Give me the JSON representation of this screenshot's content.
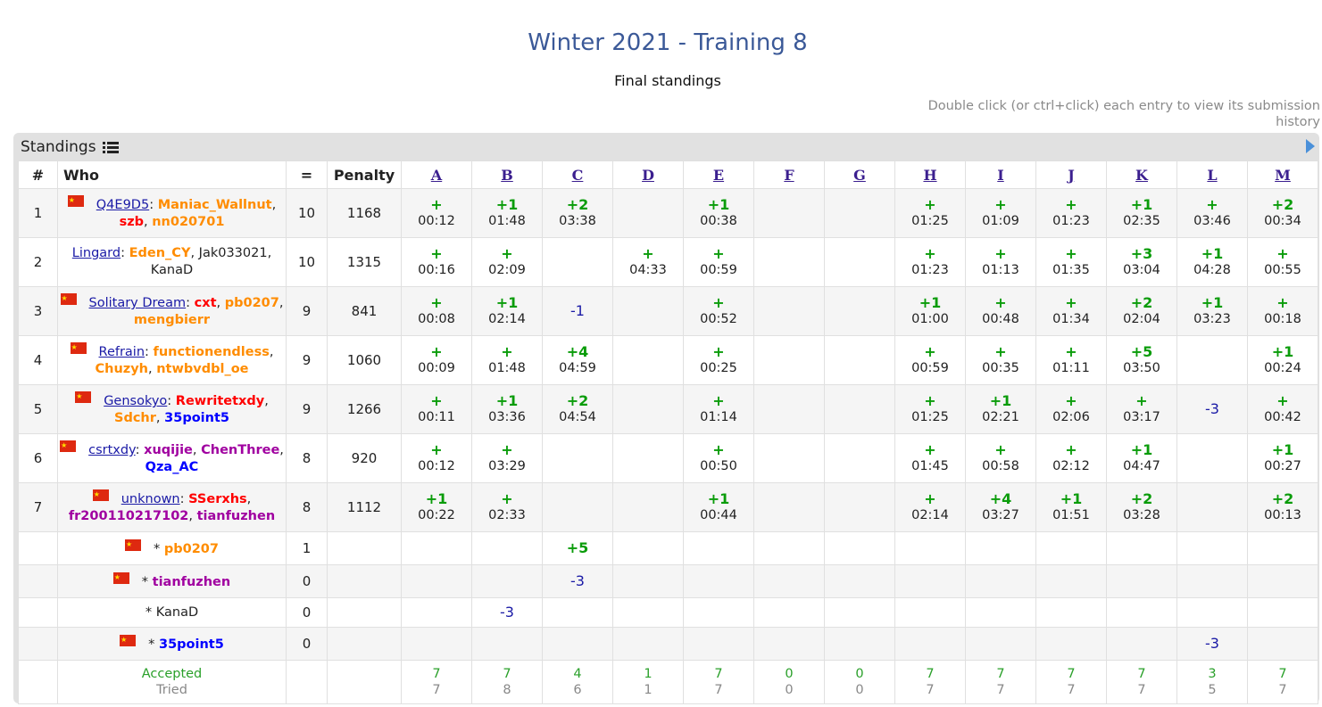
{
  "header": {
    "title": "Winter 2021 - Training 8",
    "subtitle": "Final standings",
    "hint": "Double click (or ctrl+click) each entry to view its submission history"
  },
  "panel": {
    "title": "Standings"
  },
  "columns": {
    "rank": "#",
    "who": "Who",
    "solved": "=",
    "penalty": "Penalty",
    "problems": [
      "A",
      "B",
      "C",
      "D",
      "E",
      "F",
      "G",
      "H",
      "I",
      "J",
      "K",
      "L",
      "M"
    ]
  },
  "rows": [
    {
      "rank": "1",
      "flag": true,
      "team": "Q4E9D5",
      "members": [
        {
          "name": "Maniac_Wallnut",
          "color": "orange"
        },
        {
          "name": "szb",
          "color": "red"
        },
        {
          "name": "nn020701",
          "color": "orange"
        }
      ],
      "solved": "10",
      "penalty": "1168",
      "cells": [
        [
          "+",
          "00:12"
        ],
        [
          "+1",
          "01:48"
        ],
        [
          "+2",
          "03:38"
        ],
        null,
        [
          "+1",
          "00:38"
        ],
        null,
        null,
        [
          "+",
          "01:25"
        ],
        [
          "+",
          "01:09"
        ],
        [
          "+",
          "01:23"
        ],
        [
          "+1",
          "02:35"
        ],
        [
          "+",
          "03:46"
        ],
        [
          "+2",
          "00:34"
        ]
      ]
    },
    {
      "rank": "2",
      "flag": false,
      "team": "Lingard",
      "members": [
        {
          "name": "Eden_CY",
          "color": "orange"
        },
        {
          "name": "Jak033021",
          "color": "gray"
        },
        {
          "name": "KanaD",
          "color": "gray"
        }
      ],
      "solved": "10",
      "penalty": "1315",
      "cells": [
        [
          "+",
          "00:16"
        ],
        [
          "+",
          "02:09"
        ],
        null,
        [
          "+",
          "04:33"
        ],
        [
          "+",
          "00:59"
        ],
        null,
        null,
        [
          "+",
          "01:23"
        ],
        [
          "+",
          "01:13"
        ],
        [
          "+",
          "01:35"
        ],
        [
          "+3",
          "03:04"
        ],
        [
          "+1",
          "04:28"
        ],
        [
          "+",
          "00:55"
        ]
      ]
    },
    {
      "rank": "3",
      "flag": true,
      "team": "Solitary Dream",
      "members": [
        {
          "name": "cxt",
          "color": "red"
        },
        {
          "name": "pb0207",
          "color": "orange"
        },
        {
          "name": "mengbierr",
          "color": "orange"
        }
      ],
      "solved": "9",
      "penalty": "841",
      "cells": [
        [
          "+",
          "00:08"
        ],
        [
          "+1",
          "02:14"
        ],
        [
          "-1",
          ""
        ],
        null,
        [
          "+",
          "00:52"
        ],
        null,
        null,
        [
          "+1",
          "01:00"
        ],
        [
          "+",
          "00:48"
        ],
        [
          "+",
          "01:34"
        ],
        [
          "+2",
          "02:04"
        ],
        [
          "+1",
          "03:23"
        ],
        [
          "+",
          "00:18"
        ]
      ]
    },
    {
      "rank": "4",
      "flag": true,
      "team": "Refrain",
      "members": [
        {
          "name": "functionendless",
          "color": "orange"
        },
        {
          "name": "Chuzyh",
          "color": "orange"
        },
        {
          "name": "ntwbvdbl_oe",
          "color": "orange"
        }
      ],
      "solved": "9",
      "penalty": "1060",
      "cells": [
        [
          "+",
          "00:09"
        ],
        [
          "+",
          "01:48"
        ],
        [
          "+4",
          "04:59"
        ],
        null,
        [
          "+",
          "00:25"
        ],
        null,
        null,
        [
          "+",
          "00:59"
        ],
        [
          "+",
          "00:35"
        ],
        [
          "+",
          "01:11"
        ],
        [
          "+5",
          "03:50"
        ],
        null,
        [
          "+1",
          "00:24"
        ]
      ]
    },
    {
      "rank": "5",
      "flag": true,
      "team": "Gensokyo",
      "members": [
        {
          "name": "Rewritetxdy",
          "color": "red"
        },
        {
          "name": "Sdchr",
          "color": "orange"
        },
        {
          "name": "35point5",
          "color": "blue"
        }
      ],
      "solved": "9",
      "penalty": "1266",
      "cells": [
        [
          "+",
          "00:11"
        ],
        [
          "+1",
          "03:36"
        ],
        [
          "+2",
          "04:54"
        ],
        null,
        [
          "+",
          "01:14"
        ],
        null,
        null,
        [
          "+",
          "01:25"
        ],
        [
          "+1",
          "02:21"
        ],
        [
          "+",
          "02:06"
        ],
        [
          "+",
          "03:17"
        ],
        [
          "-3",
          ""
        ],
        [
          "+",
          "00:42"
        ]
      ]
    },
    {
      "rank": "6",
      "flag": true,
      "team": "csrtxdy",
      "members": [
        {
          "name": "xuqijie",
          "color": "purple"
        },
        {
          "name": "ChenThree",
          "color": "purple"
        },
        {
          "name": "Qza_AC",
          "color": "blue"
        }
      ],
      "solved": "8",
      "penalty": "920",
      "cells": [
        [
          "+",
          "00:12"
        ],
        [
          "+",
          "03:29"
        ],
        null,
        null,
        [
          "+",
          "00:50"
        ],
        null,
        null,
        [
          "+",
          "01:45"
        ],
        [
          "+",
          "00:58"
        ],
        [
          "+",
          "02:12"
        ],
        [
          "+1",
          "04:47"
        ],
        null,
        [
          "+1",
          "00:27"
        ]
      ]
    },
    {
      "rank": "7",
      "flag": true,
      "team": "unknown",
      "members": [
        {
          "name": "SSerxhs",
          "color": "red"
        },
        {
          "name": "fr200110217102",
          "color": "purple"
        },
        {
          "name": "tianfuzhen",
          "color": "purple"
        }
      ],
      "solved": "8",
      "penalty": "1112",
      "cells": [
        [
          "+1",
          "00:22"
        ],
        [
          "+",
          "02:33"
        ],
        null,
        null,
        [
          "+1",
          "00:44"
        ],
        null,
        null,
        [
          "+",
          "02:14"
        ],
        [
          "+4",
          "03:27"
        ],
        [
          "+1",
          "01:51"
        ],
        [
          "+2",
          "03:28"
        ],
        null,
        [
          "+2",
          "00:13"
        ]
      ]
    }
  ],
  "unofficial": [
    {
      "flag": true,
      "name": "pb0207",
      "color": "orange",
      "solved": "1",
      "cells": [
        null,
        null,
        [
          "+5",
          ""
        ],
        null,
        null,
        null,
        null,
        null,
        null,
        null,
        null,
        null,
        null
      ]
    },
    {
      "flag": true,
      "name": "tianfuzhen",
      "color": "purple",
      "solved": "0",
      "cells": [
        null,
        null,
        [
          "-3",
          ""
        ],
        null,
        null,
        null,
        null,
        null,
        null,
        null,
        null,
        null,
        null
      ]
    },
    {
      "flag": false,
      "name": "KanaD",
      "color": "gray",
      "solved": "0",
      "cells": [
        null,
        [
          "-3",
          ""
        ],
        null,
        null,
        null,
        null,
        null,
        null,
        null,
        null,
        null,
        null,
        null
      ]
    },
    {
      "flag": true,
      "name": "35point5",
      "color": "blue",
      "solved": "0",
      "cells": [
        null,
        null,
        null,
        null,
        null,
        null,
        null,
        null,
        null,
        null,
        null,
        [
          "-3",
          ""
        ],
        null
      ]
    }
  ],
  "footer": {
    "accepted_label": "Accepted",
    "tried_label": "Tried",
    "accepted": [
      "7",
      "7",
      "4",
      "1",
      "7",
      "0",
      "0",
      "7",
      "7",
      "7",
      "7",
      "3",
      "7"
    ],
    "tried": [
      "7",
      "8",
      "6",
      "1",
      "7",
      "0",
      "0",
      "7",
      "7",
      "7",
      "7",
      "5",
      "7"
    ]
  }
}
